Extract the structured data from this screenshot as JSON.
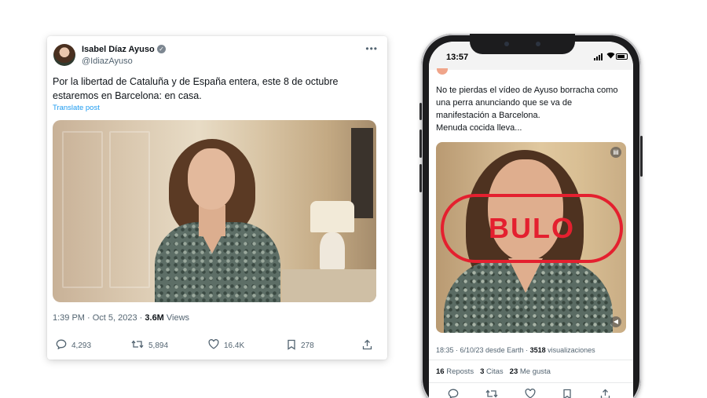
{
  "tweet": {
    "author_name": "Isabel Díaz Ayuso",
    "author_handle": "@IdiazAyuso",
    "text": "Por la libertad de Cataluña y de España entera, este 8 de octubre estaremos en Barcelona: en casa.",
    "translate_label": "Translate post",
    "timestamp": "1:39 PM · Oct 5, 2023 · ",
    "views_count": "3.6M",
    "views_label": " Views",
    "actions": {
      "replies": "4,293",
      "reposts": "5,894",
      "likes": "16.4K",
      "bookmarks": "278"
    }
  },
  "phone": {
    "status_time": "13:57",
    "post_text_lines": [
      "No te pierdas el vídeo de Ayuso borracha como",
      "una perra anunciando que se va de",
      "manifestación a Barcelona.",
      "Menuda cocida lleva..."
    ],
    "stamp_label": "BULO",
    "meta_prefix": "18:35 · 6/10/23 desde Earth · ",
    "views_count": "3518",
    "views_label": " visualizaciones",
    "stats": {
      "reposts_count": "16",
      "reposts_label": "Reposts",
      "quotes_count": "3",
      "quotes_label": "Citas",
      "likes_count": "23",
      "likes_label": "Me gusta"
    }
  },
  "colors": {
    "link_blue": "#1d9bf0",
    "stamp_red": "#e4202f",
    "muted_text": "#536471"
  },
  "icons": [
    "verified-badge-icon",
    "more-icon",
    "reply-icon",
    "repost-icon",
    "like-icon",
    "bookmark-icon",
    "share-icon",
    "grok-icon",
    "mute-icon",
    "signal-icon",
    "wifi-icon",
    "battery-icon"
  ]
}
